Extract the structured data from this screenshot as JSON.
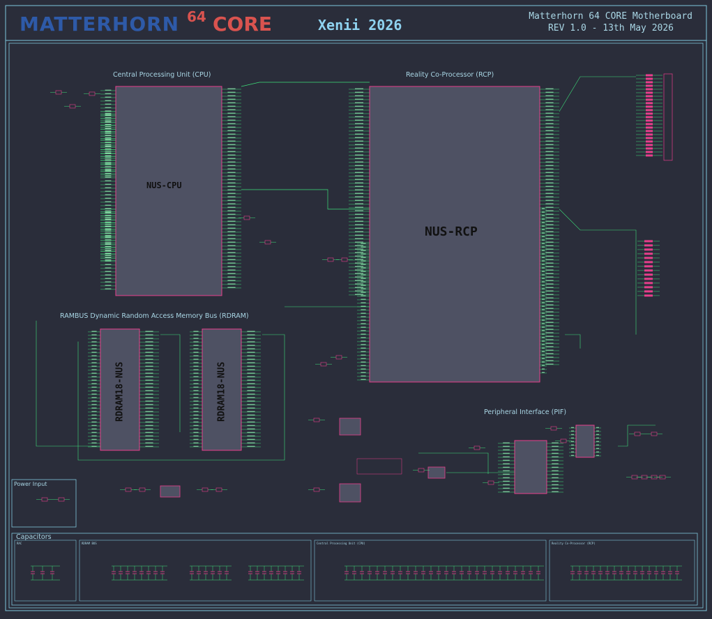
{
  "header": {
    "logo_main": "MATTERHORN",
    "logo_superscript": "64",
    "logo_suffix": "CORE",
    "author": "Xenii 2026",
    "board_title": "Matterhorn 64 CORE Motherboard",
    "revision": "REV 1.0 - 13th May 2026"
  },
  "sections": {
    "cpu_title": "Central Processing Unit (CPU)",
    "rcp_title": "Reality Co-Processor (RCP)",
    "rdram_title": "RAMBUS Dynamic Random Access Memory Bus (RDRAM)",
    "pif_title": "Peripheral Interface (PIF)",
    "power_title": "Power Input",
    "capacitors_title": "Capacitors"
  },
  "chips": {
    "cpu": "NUS-CPU",
    "rcp": "NUS-RCP",
    "rdram_1": "RDRAM18-NUS",
    "rdram_2": "RDRAM18-NUS"
  },
  "capacitor_groups": {
    "g1": "RAC",
    "g2": "RDRAM BUS",
    "g3": "Central Processing Unit (CPU)",
    "g4": "Reality Co-Processor (RCP)"
  },
  "colors": {
    "background": "#2a2d3a",
    "wire": "#3ee07a",
    "component": "#e83e8c",
    "chip_fill": "#4e5163",
    "frame": "#7fc6dc",
    "text": "#a9d6e5"
  }
}
